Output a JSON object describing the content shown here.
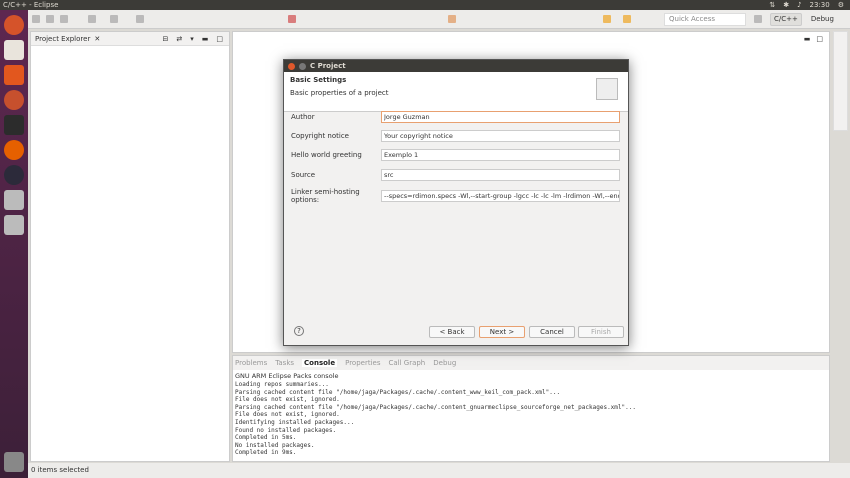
{
  "window_title": "C/C++ - Eclipse",
  "system_tray": {
    "clock": "23:30"
  },
  "toolbar": {
    "quick_access_placeholder": "Quick Access",
    "perspectives": [
      "C/C++",
      "Debug"
    ]
  },
  "project_explorer": {
    "title": "Project Explorer"
  },
  "status_bar": {
    "text": "0 items selected"
  },
  "dialog": {
    "title": "C Project",
    "header_title": "Basic Settings",
    "header_desc": "Basic properties of a project",
    "fields": [
      {
        "label": "Author",
        "value": "Jorge Guzman"
      },
      {
        "label": "Copyright notice",
        "value": "Your copyright notice"
      },
      {
        "label": "Hello world greeting",
        "value": "Exemplo 1"
      },
      {
        "label": "Source",
        "value": "src"
      },
      {
        "label": "Linker semi-hosting options:",
        "value": "--specs=rdimon.specs -Wl,--start-group -lgcc -lc -lc -lm -lrdimon -Wl,--end-group"
      }
    ],
    "buttons": {
      "back": "< Back",
      "next": "Next >",
      "cancel": "Cancel",
      "finish": "Finish",
      "help": "?"
    }
  },
  "console": {
    "tabs": [
      "Problems",
      "Tasks",
      "Console",
      "Properties",
      "Call Graph",
      "Debug"
    ],
    "title": "GNU ARM Eclipse Packs console",
    "output": "Loading repos summaries...\nParsing cached content file \"/home/jaga/Packages/.cache/.content_www_keil_com_pack.xml\"...\nFile does not exist, ignored.\nParsing cached content file \"/home/jaga/Packages/.cache/.content_gnuarmeclipse_sourceforge_net_packages.xml\"...\nFile does not exist, ignored.\nIdentifying installed packages...\nFound no installed packages.\nCompleted in 5ms.\nNo installed packages.\nCompleted in 9ms."
  }
}
